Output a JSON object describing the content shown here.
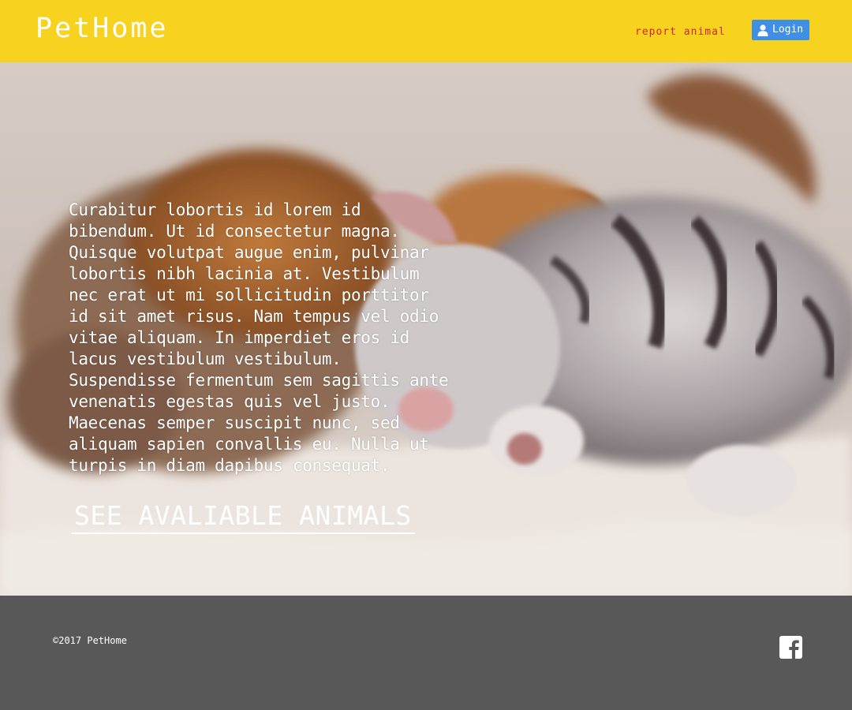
{
  "header": {
    "brand": "PetHome",
    "report_link": "report animal",
    "login_label": "Login",
    "colors": {
      "background": "#f7d31f",
      "report_link": "#d8222a",
      "login_button": "#3f8fe6"
    }
  },
  "hero": {
    "paragraph": "Curabitur lobortis id lorem id bibendum. Ut id consectetur magna. Quisque volutpat augue enim, pulvinar lobortis nibh lacinia at. Vestibulum nec erat ut mi sollicitudin porttitor id sit amet risus. Nam tempus vel odio vitae aliquam. In imperdiet eros id lacus vestibulum vestibulum. Suspendisse fermentum sem sagittis ante venenatis egestas quis vel justo. Maecenas semper suscipit nunc, sed aliquam sapien convallis eu. Nulla ut turpis in diam dapibus consequat.",
    "cta": "SEE AVALIABLE ANIMALS"
  },
  "footer": {
    "copyright": "©2017 PetHome",
    "social_icon": "facebook-icon",
    "background": "#585858"
  }
}
